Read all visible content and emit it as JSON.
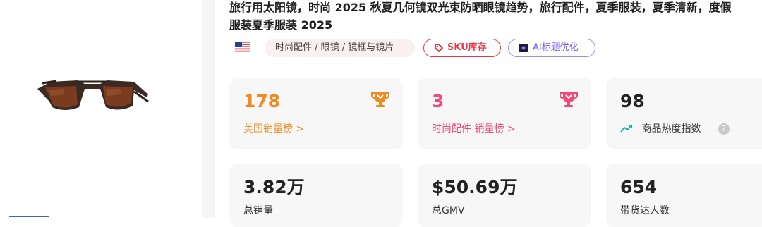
{
  "product": {
    "title_line1": "旅行用太阳镜，时尚 2025 秋夏几何镜双光束防晒眼镜趋势，旅行配件，夏季服装，夏季清新，度假",
    "title_line2": "服装夏季服装 2025"
  },
  "tags": {
    "category_path": "时尚配件 / 眼镜 / 镜框与镜片",
    "sku_label": "SKU库存",
    "ai_label": "AI标题优化"
  },
  "stats": {
    "rank_us": {
      "value": "178",
      "label": "美国销量榜 >"
    },
    "rank_category": {
      "value": "3",
      "label": "时尚配件 销量榜 >"
    },
    "heat": {
      "value": "98",
      "label": "商品热度指数",
      "help": "?"
    },
    "total_sales": {
      "value": "3.82万",
      "label": "总销量"
    },
    "total_gmv": {
      "value": "$50.69万",
      "label": "总GMV"
    },
    "influencers": {
      "value": "654",
      "label": "带货达人数"
    }
  },
  "colors": {
    "accent_orange": "#f08a1e",
    "accent_pink": "#f04a7a",
    "accent_red": "#e5394a",
    "accent_purple": "#7b61e8",
    "trend_teal": "#1fb5a6"
  }
}
